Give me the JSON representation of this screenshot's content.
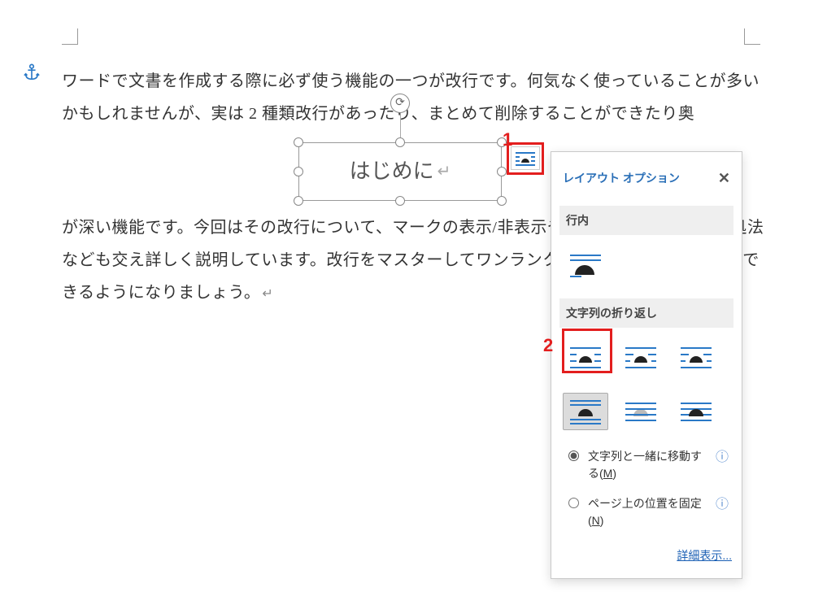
{
  "document": {
    "paragraph1": "ワードで文書を作成する際に必ず使う機能の一つが改行です。何気なく使っていることが多いかもしれませんが、実は 2 種類改行があったり、まとめて削除することができたり奥",
    "paragraph2": "が深い機能です。今回はその改行について、マークの表示/非表示や置換、削除方法など対処法なども交え詳しく説明しています。改行をマスターしてワンランク上の文章を効率的に作成できるようになりましょう。",
    "textbox_text": "はじめに"
  },
  "annotations": {
    "label1": "1",
    "label2": "2"
  },
  "panel": {
    "title": "レイアウト オプション",
    "section_inline": "行内",
    "section_wrap": "文字列の折り返し",
    "radio_move_with_text": "文字列と一緒に移動する(",
    "radio_move_with_text_key": "M",
    "radio_move_with_text_close": ")",
    "radio_fix_position": "ページ上の位置を固定(",
    "radio_fix_position_key": "N",
    "radio_fix_position_close": ")",
    "more_link": "詳細表示...",
    "close_glyph": "✕",
    "info_glyph": "ⓘ"
  },
  "icons": {
    "anchor": "anchor",
    "rotate": "⟳"
  }
}
